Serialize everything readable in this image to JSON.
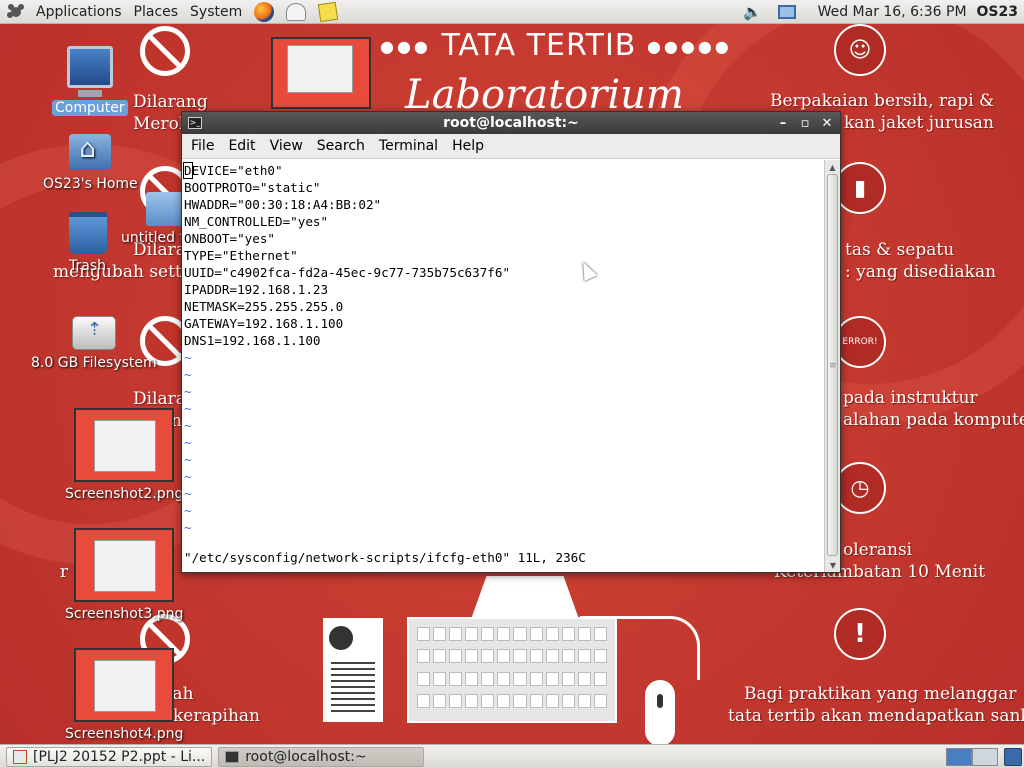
{
  "top_panel": {
    "menus": [
      "Applications",
      "Places",
      "System"
    ],
    "launchers": [
      "firefox-icon",
      "mail-icon",
      "notes-icon"
    ],
    "clock": "Wed Mar 16,  6:36 PM",
    "username": "OS23"
  },
  "wallpaper": {
    "heading": "TATA TERTIB",
    "script_heading": "Laboratorium",
    "texts": {
      "dilarang1_a": "Dilarang",
      "dilarang1_b": "Merok",
      "dilarang2": "Dilarang",
      "dilarang3": "Dilaran",
      "dilarang3_b": "n",
      "mengubah": "mengubah setting",
      "r_line": "r",
      "l_line": "l",
      "lah": "lah",
      "kerapihan": "kerapihan",
      "attire_1": "Berpakaian bersih, rapi &",
      "attire_2": "kan jaket jurusan",
      "bags_1": "tas & sepatu",
      "bags_2": ": yang disediakan",
      "error_1": "pada instruktur",
      "error_2": "alahan pada komputer",
      "error_badge": "ERROR!",
      "late_1": "oleransi",
      "late_2": "Keterlambatan 10 Menit",
      "sanction_1": "Bagi praktikan yang melanggar",
      "sanction_2": "tata tertib akan mendapatkan sanksi"
    }
  },
  "desktop_icons": [
    {
      "label": "Computer",
      "icon": "computer-icon"
    },
    {
      "label": "OS23's Home",
      "icon": "home-folder-icon"
    },
    {
      "label": "Trash",
      "icon": "trash-icon"
    },
    {
      "label": "untitled f",
      "icon": "folder-icon"
    },
    {
      "label": "8.0 GB Filesystem",
      "icon": "usb-drive-icon"
    },
    {
      "label": "Screenshot2.png",
      "icon": "image-thumbnail-icon"
    },
    {
      "label": "Screenshot3.png",
      "icon": "image-thumbnail-icon"
    },
    {
      "label": "Screenshot4.png",
      "icon": "image-thumbnail-icon"
    }
  ],
  "terminal": {
    "title": "root@localhost:~",
    "menu": [
      "File",
      "Edit",
      "View",
      "Search",
      "Terminal",
      "Help"
    ],
    "lines": [
      "DEVICE=\"eth0\"",
      "BOOTPROTO=\"static\"",
      "HWADDR=\"00:30:18:A4:BB:02\"",
      "NM_CONTROLLED=\"yes\"",
      "ONBOOT=\"yes\"",
      "TYPE=\"Ethernet\"",
      "UUID=\"c4902fca-fd2a-45ec-9c77-735b75c637f6\"",
      "IPADDR=192.168.1.23",
      "NETMASK=255.255.255.0",
      "GATEWAY=192.168.1.100",
      "DNS1=192.168.1.100"
    ],
    "cursor_char": "D",
    "first_line_rest": "EVICE=\"eth0\"",
    "tilde": "~",
    "status": "\"/etc/sysconfig/network-scripts/ifcfg-eth0\" 11L, 236C"
  },
  "bottom_panel": {
    "tasks": [
      "[PLJ2 20152 P2.ppt - Li...",
      "root@localhost:~"
    ]
  }
}
